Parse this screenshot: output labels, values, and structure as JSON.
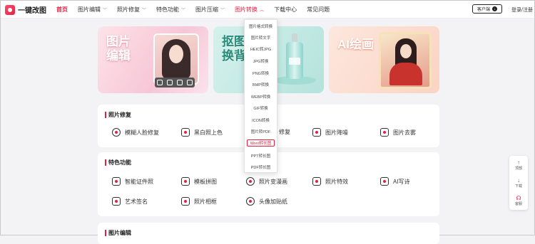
{
  "header": {
    "logo_text": "一键改图",
    "nav": [
      {
        "label": "首页",
        "state": "active",
        "chevron": false
      },
      {
        "label": "图片编辑",
        "state": "normal",
        "chevron": true
      },
      {
        "label": "照片修复",
        "state": "normal",
        "chevron": true
      },
      {
        "label": "特色功能",
        "state": "normal",
        "chevron": true
      },
      {
        "label": "图片压缩",
        "state": "normal",
        "chevron": true
      },
      {
        "label": "图片转换",
        "state": "open",
        "chevron": true
      },
      {
        "label": "下载中心",
        "state": "normal",
        "chevron": false
      },
      {
        "label": "常见问题",
        "state": "normal",
        "chevron": false
      }
    ],
    "client_button": "客户端",
    "login": "登录/注册"
  },
  "banners": [
    {
      "title_line1": "图片",
      "title_line2": "编辑"
    },
    {
      "title_line1": "抠图",
      "title_line2": "换背"
    },
    {
      "title_line1": "AI绘画",
      "title_line2": ""
    }
  ],
  "dropdown": {
    "items": [
      "图片格式转换",
      "图片转文字",
      "HEIC转JPG",
      "JPG转换",
      "PNG转换",
      "BMP转换",
      "WEBP转换",
      "GIF转换",
      "ICON转换",
      "图片转PDF",
      "Word转长图",
      "PPT转长图",
      "PDF转长图"
    ],
    "selected": "Word转长图"
  },
  "sections": [
    {
      "title": "照片修复",
      "tools": [
        {
          "label": "模糊人脸修复",
          "icon": "face-icon"
        },
        {
          "label": "黑白照上色",
          "icon": "palette-icon"
        },
        {
          "label": "修复",
          "icon": "repair-icon"
        },
        {
          "label": "图片降噪",
          "icon": "denoise-icon"
        },
        {
          "label": "图片去雾",
          "icon": "defog-icon"
        }
      ]
    },
    {
      "title": "特色功能",
      "tools": [
        {
          "label": "智能证件照",
          "icon": "id-photo-icon"
        },
        {
          "label": "模板拼图",
          "icon": "grid-icon"
        },
        {
          "label": "照片变漫画",
          "icon": "cartoon-icon"
        },
        {
          "label": "照片特效",
          "icon": "sparkle-icon"
        },
        {
          "label": "AI写诗",
          "icon": "pen-icon"
        },
        {
          "label": "艺术签名",
          "icon": "signature-icon"
        },
        {
          "label": "照片相框",
          "icon": "frame-icon"
        },
        {
          "label": "头像加贴纸",
          "icon": "sticker-icon"
        }
      ]
    },
    {
      "title": "图片编辑",
      "tools": []
    }
  ],
  "sidebar": {
    "items": [
      {
        "label": "顶部",
        "icon": "arrow-up-icon"
      },
      {
        "label": "下载",
        "icon": "arrow-down-icon"
      },
      {
        "label": "客服",
        "icon": "headset-icon"
      }
    ]
  },
  "colors": {
    "accent": "#e6213f"
  }
}
